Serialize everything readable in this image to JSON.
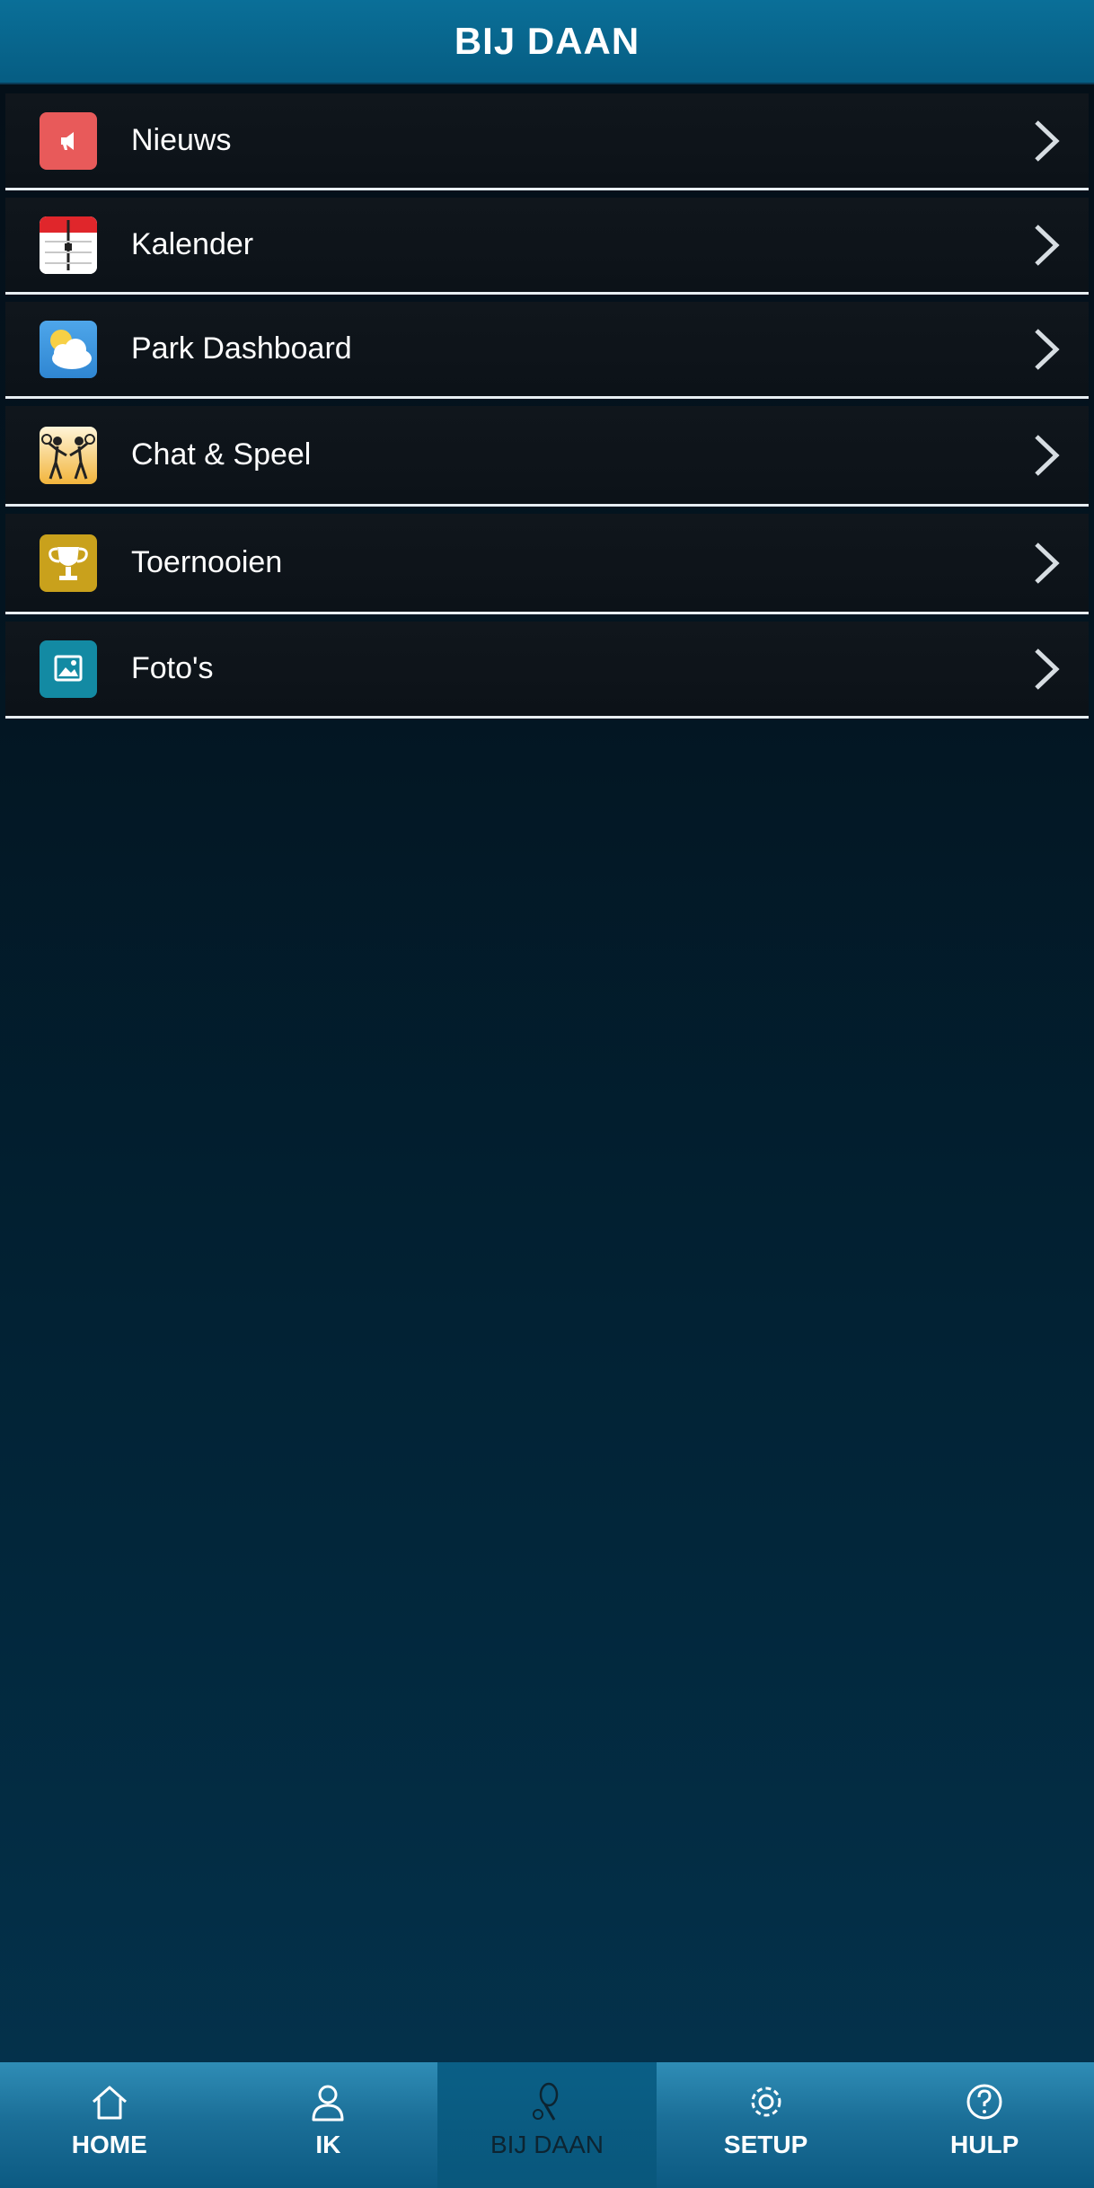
{
  "header": {
    "title": "BIJ DAAN"
  },
  "menu": {
    "items": [
      {
        "label": "Nieuws",
        "icon": "megaphone-icon"
      },
      {
        "label": "Kalender",
        "icon": "calendar-icon"
      },
      {
        "label": "Park Dashboard",
        "icon": "weather-icon"
      },
      {
        "label": "Chat & Speel",
        "icon": "players-icon"
      },
      {
        "label": "Toernooien",
        "icon": "trophy-icon"
      },
      {
        "label": "Foto's",
        "icon": "photo-icon"
      }
    ]
  },
  "tabbar": {
    "tabs": [
      {
        "label": "HOME",
        "icon": "home-icon",
        "active": false
      },
      {
        "label": "IK",
        "icon": "user-icon",
        "active": false
      },
      {
        "label": "BIJ DAAN",
        "icon": "racket-icon",
        "active": true
      },
      {
        "label": "SETUP",
        "icon": "gear-icon",
        "active": false
      },
      {
        "label": "HULP",
        "icon": "help-icon",
        "active": false
      }
    ]
  },
  "colors": {
    "header_bg": "#0a6f98",
    "tabbar_bg": "#1b6f98",
    "item_border": "#e8eef2",
    "news_icon": "#e85a5a",
    "trophy_icon": "#c9a11c",
    "photo_icon": "#138aa3"
  }
}
